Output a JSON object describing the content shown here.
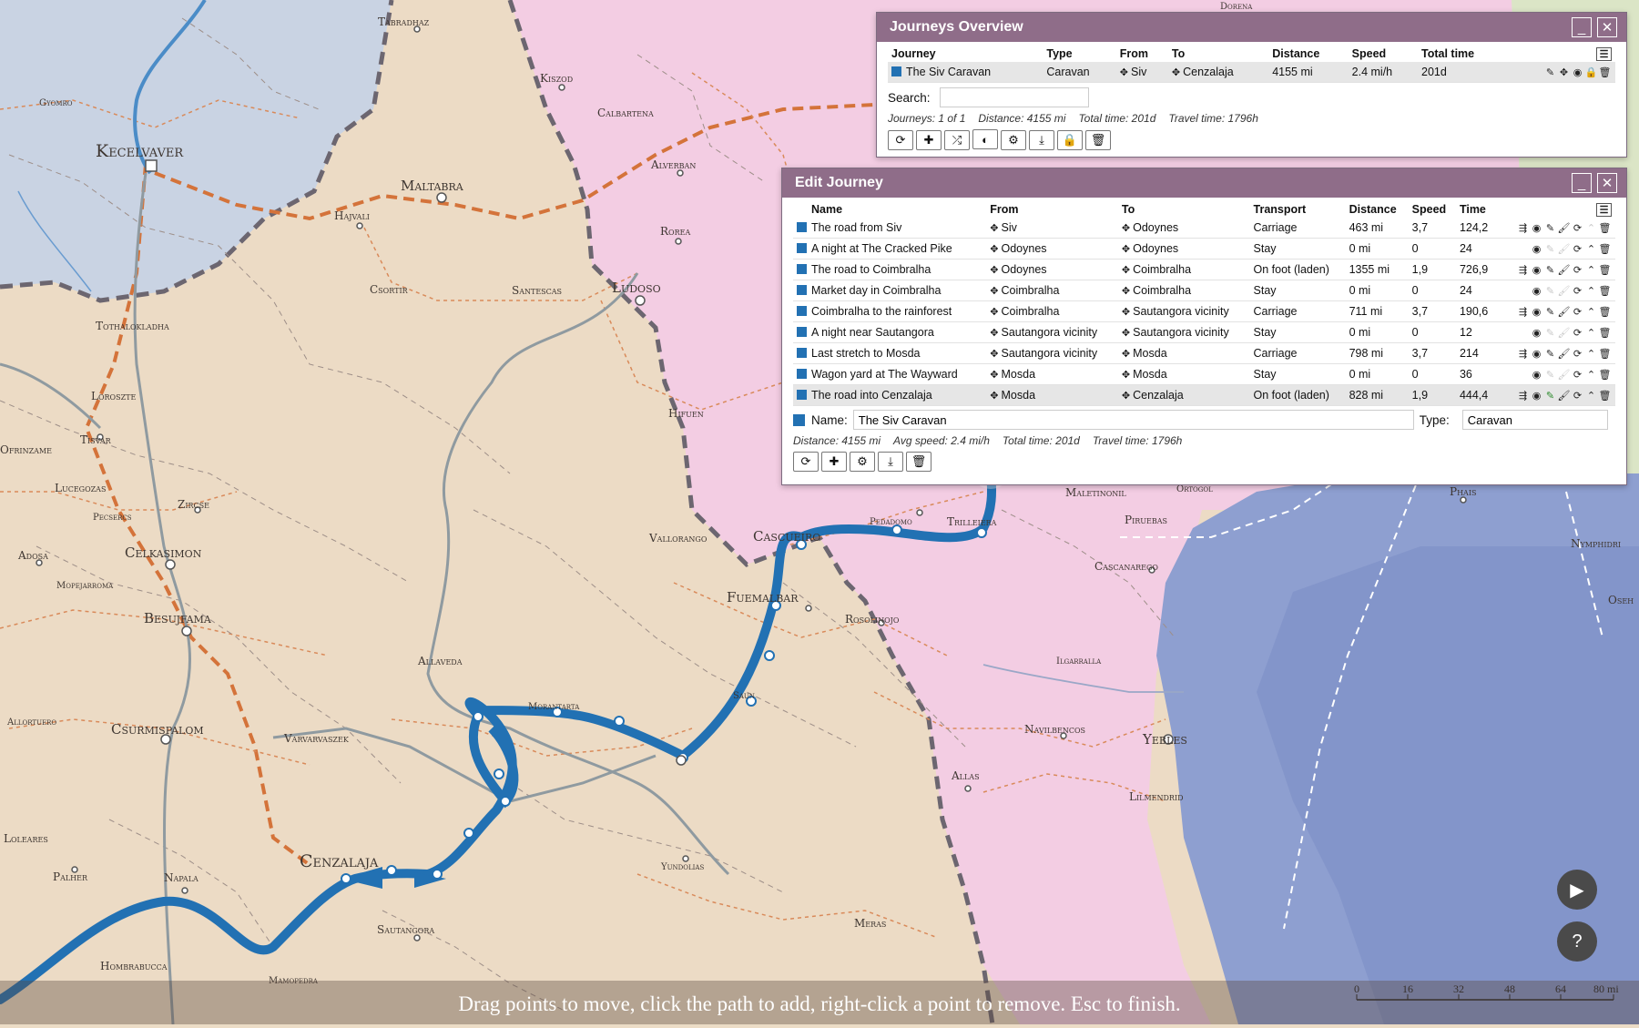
{
  "overview": {
    "title": "Journeys Overview",
    "columns": [
      "Journey",
      "Type",
      "From",
      "To",
      "Distance",
      "Speed",
      "Total time"
    ],
    "row": {
      "journey": "The Siv Caravan",
      "type": "Caravan",
      "from": "Siv",
      "to": "Cenzalaja",
      "distance": "4155 mi",
      "speed": "2.4 mi/h",
      "total_time": "201d"
    },
    "search_label": "Search:",
    "search_value": "",
    "stats": {
      "journeys": "Journeys: 1 of 1",
      "distance": "Distance: 4155 mi",
      "total_time": "Total time: 201d",
      "travel_time": "Travel time: 1796h"
    }
  },
  "edit": {
    "title": "Edit Journey",
    "columns": [
      "Name",
      "From",
      "To",
      "Transport",
      "Distance",
      "Speed",
      "Time"
    ],
    "rows": [
      {
        "name": "The road from Siv",
        "from": "Siv",
        "to": "Odoynes",
        "transport": "Carriage",
        "distance": "463 mi",
        "speed": "3,7",
        "time": "124,2"
      },
      {
        "name": "A night at The Cracked Pike",
        "from": "Odoynes",
        "to": "Odoynes",
        "transport": "Stay",
        "distance": "0 mi",
        "speed": "0",
        "time": "24"
      },
      {
        "name": "The road to Coimbralha",
        "from": "Odoynes",
        "to": "Coimbralha",
        "transport": "On foot (laden)",
        "distance": "1355 mi",
        "speed": "1,9",
        "time": "726,9"
      },
      {
        "name": "Market day in Coimbralha",
        "from": "Coimbralha",
        "to": "Coimbralha",
        "transport": "Stay",
        "distance": "0 mi",
        "speed": "0",
        "time": "24"
      },
      {
        "name": "Coimbralha to the rainforest",
        "from": "Coimbralha",
        "to": "Sautangora vicinity",
        "transport": "Carriage",
        "distance": "711 mi",
        "speed": "3,7",
        "time": "190,6"
      },
      {
        "name": "A night near Sautangora",
        "from": "Sautangora vicinity",
        "to": "Sautangora vicinity",
        "transport": "Stay",
        "distance": "0 mi",
        "speed": "0",
        "time": "12"
      },
      {
        "name": "Last stretch to Mosda",
        "from": "Sautangora vicinity",
        "to": "Mosda",
        "transport": "Carriage",
        "distance": "798 mi",
        "speed": "3,7",
        "time": "214"
      },
      {
        "name": "Wagon yard at The Wayward",
        "from": "Mosda",
        "to": "Mosda",
        "transport": "Stay",
        "distance": "0 mi",
        "speed": "0",
        "time": "36"
      },
      {
        "name": "The road into Cenzalaja",
        "from": "Mosda",
        "to": "Cenzalaja",
        "transport": "On foot (laden)",
        "distance": "828 mi",
        "speed": "1,9",
        "time": "444,4"
      }
    ],
    "name_label": "Name:",
    "name_value": "The Siv Caravan",
    "type_label": "Type:",
    "type_value": "Caravan",
    "stats": {
      "distance": "Distance: 4155 mi",
      "avg_speed": "Avg speed: 2.4 mi/h",
      "total_time": "Total time: 201d",
      "travel_time": "Travel time: 1796h"
    }
  },
  "map_labels": {
    "kecelvaver": "Kecelvaver",
    "tabradhaz": "Tabradhaz",
    "kiszod": "Kiszod",
    "calbartena": "Calbartena",
    "alverban": "Alverban",
    "rorea": "Rorea",
    "maltabra": "Maltabra",
    "hajvali": "Hajvali",
    "gyomro": "Gyomro",
    "csortir": "Csortir",
    "santescas": "Santescas",
    "ludoso": "Ludoso",
    "tothalokladha": "Tothalokladha",
    "loroszte": "Loroszte",
    "tisvar": "Tisvar",
    "ofrinzame": "Ofrinzame",
    "lucegozas": "Lucegozas",
    "zircse": "Zircse",
    "pecsercs": "Pecsercs",
    "adosa": "Adosa",
    "celkasimon": "Celkasimon",
    "mopejarroma": "Mopejarroma",
    "besujfama": "Besujfama",
    "hifuen": "Hifuen",
    "vallorango": "Vallorango",
    "casceuc": "Cascueiro",
    "pedadomo": "Pedadomo",
    "trilleiera": "Trilleiera",
    "fuemalbar": "Fuemalbar",
    "rosolinojo": "Rosolinojo",
    "allaveda": "Allaveda",
    "morantarta": "Morantarta",
    "saun": "Saun",
    "csurmispalom": "Csurmispalom",
    "varvarvaszek": "Varvarvaszek",
    "allortuero": "Allortuero",
    "loleares": "Loleares",
    "palher": "Palher",
    "napala": "Napala",
    "cenzalaja": "Cenzalaja",
    "sautangora": "Sautangora",
    "yundolias": "Yundolias",
    "hombrabucca": "Hombrabucca",
    "mamopedra": "Mamopedra",
    "meras": "Meras",
    "allas": "Allas",
    "navilbencos": "Navilbencos",
    "yebles": "Yebles",
    "lilmendrid": "Lilmendrid",
    "ilgarralla": "Ilgarralla",
    "cascanarego": "Cascanarego",
    "piruebas": "Piruebas",
    "maletinonil": "Maletinonil",
    "ortogol": "Ortogol",
    "phais": "Phais",
    "nymphidri": "Nymphidri",
    "dorena": "Dorena",
    "oseh": "Oseh"
  },
  "scale": {
    "ticks": [
      "0",
      "16",
      "32",
      "48",
      "64",
      "80 mi"
    ]
  },
  "hint": "Drag points to move, click the path to add, right-click a point to remove. Esc to finish."
}
